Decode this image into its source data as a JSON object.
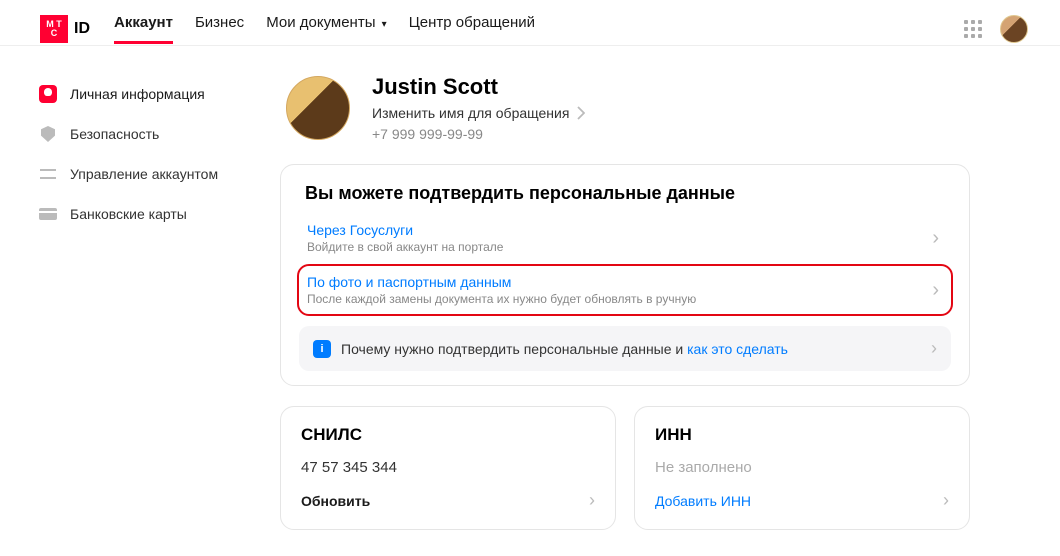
{
  "header": {
    "logo_text": "ID",
    "logo_box_1": "M T",
    "logo_box_2": "C",
    "nav": [
      {
        "label": "Аккаунт",
        "active": true
      },
      {
        "label": "Бизнес",
        "active": false
      },
      {
        "label": "Мои документы",
        "active": false,
        "dropdown": true
      },
      {
        "label": "Центр обращений",
        "active": false
      }
    ]
  },
  "sidebar": {
    "items": [
      {
        "label": "Личная информация",
        "icon": "person",
        "active": true
      },
      {
        "label": "Безопасность",
        "icon": "shield",
        "active": false
      },
      {
        "label": "Управление аккаунтом",
        "icon": "sliders",
        "active": false
      },
      {
        "label": "Банковские карты",
        "icon": "card",
        "active": false
      }
    ]
  },
  "profile": {
    "name": "Justin Scott",
    "change_name_label": "Изменить имя для обращения",
    "phone": "+7 999 999-99-99"
  },
  "verify_card": {
    "title": "Вы можете подтвердить персональные данные",
    "options": [
      {
        "title": "Через Госуслуги",
        "desc": "Войдите в свой аккаунт на портале",
        "highlighted": false
      },
      {
        "title": "По фото и паспортным данным",
        "desc": "После каждой замены документа их нужно будет обновлять в ручную",
        "highlighted": true
      }
    ],
    "info_prefix": "Почему нужно подтвердить персональные данные и ",
    "info_link": "как это сделать"
  },
  "snils": {
    "title": "СНИЛС",
    "value": "47 57 345 344",
    "action": "Обновить"
  },
  "inn": {
    "title": "ИНН",
    "value": "Не заполнено",
    "action": "Добавить ИНН"
  }
}
